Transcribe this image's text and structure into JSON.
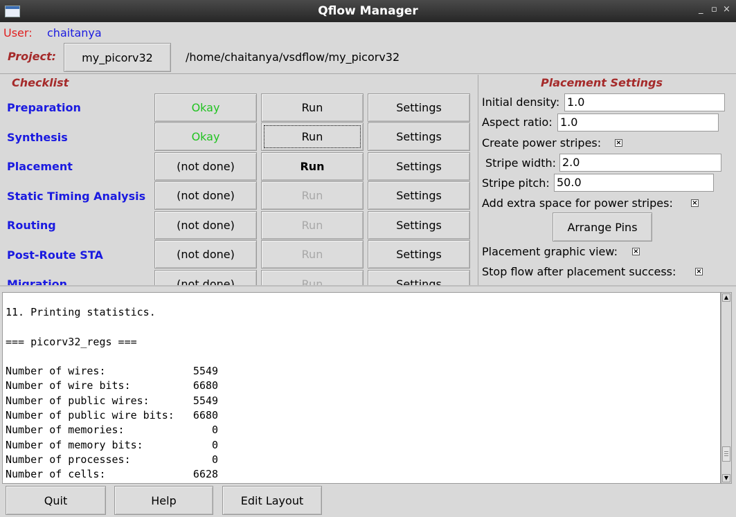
{
  "window": {
    "title": "Qflow Manager",
    "controls": {
      "minimize": "_",
      "maximize": "▫",
      "close": "×"
    }
  },
  "user": {
    "label": "User:",
    "name": "chaitanya"
  },
  "project": {
    "label": "Project:",
    "name": "my_picorv32",
    "path": "/home/chaitanya/vsdflow/my_picorv32"
  },
  "checklist": {
    "title": "Checklist",
    "stages": [
      {
        "name": "Preparation",
        "status": "Okay",
        "run": "Run",
        "settings": "Settings"
      },
      {
        "name": "Synthesis",
        "status": "Okay",
        "run": "Run",
        "settings": "Settings"
      },
      {
        "name": "Placement",
        "status": "(not done)",
        "run": "Run",
        "settings": "Settings"
      },
      {
        "name": "Static Timing Analysis",
        "status": "(not done)",
        "run": "Run",
        "settings": "Settings"
      },
      {
        "name": "Routing",
        "status": "(not done)",
        "run": "Run",
        "settings": "Settings"
      },
      {
        "name": "Post-Route STA",
        "status": "(not done)",
        "run": "Run",
        "settings": "Settings"
      },
      {
        "name": "Migration",
        "status": "(not done)",
        "run": "Run",
        "settings": "Settings"
      }
    ]
  },
  "placement_settings": {
    "title": "Placement Settings",
    "initial_density": {
      "label": "Initial density:",
      "value": "1.0"
    },
    "aspect_ratio": {
      "label": "Aspect ratio:",
      "value": "1.0"
    },
    "create_power_stripes": {
      "label": "Create power stripes:",
      "checked": true
    },
    "stripe_width": {
      "label": "Stripe width:",
      "value": "2.0"
    },
    "stripe_pitch": {
      "label": "Stripe pitch:",
      "value": "50.0"
    },
    "extra_space": {
      "label": "Add extra space for power stripes:",
      "checked": true
    },
    "arrange_pins": "Arrange Pins",
    "graphic_view": {
      "label": "Placement graphic view:",
      "checked": true
    },
    "stop_after": {
      "label": "Stop flow after placement success:",
      "checked": true
    },
    "check_mark": "×"
  },
  "console": {
    "text": "11. Printing statistics.\n\n=== picorv32_regs ===\n\nNumber of wires:              5549\nNumber of wire bits:          6680\nNumber of public wires:       5549\nNumber of public wire bits:   6680\nNumber of memories:              0\nNumber of memory bits:           0\nNumber of processes:             0\nNumber of cells:              6628",
    "scroll_up": "▲",
    "scroll_down": "▼"
  },
  "footer": {
    "quit": "Quit",
    "help": "Help",
    "edit_layout": "Edit Layout"
  }
}
